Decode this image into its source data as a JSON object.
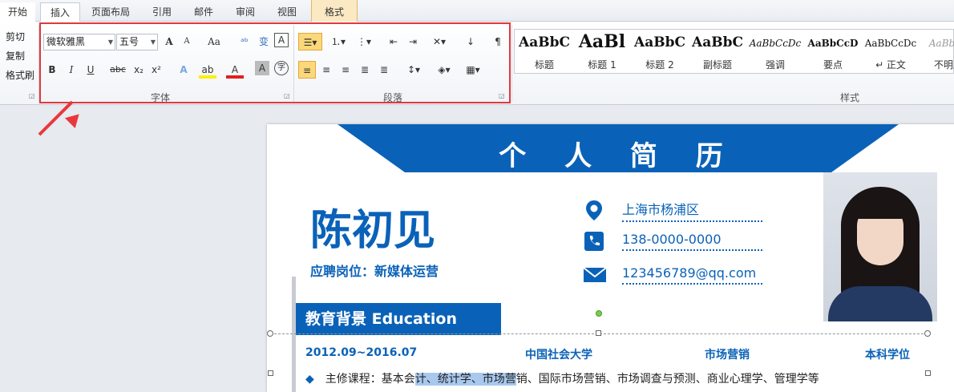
{
  "tabs": [
    {
      "label": "开始",
      "active": true
    },
    {
      "label": "插入",
      "active": false
    },
    {
      "label": "页面布局",
      "active": false
    },
    {
      "label": "引用",
      "active": false
    },
    {
      "label": "邮件",
      "active": false
    },
    {
      "label": "审阅",
      "active": false
    },
    {
      "label": "视图",
      "active": false
    },
    {
      "label": "格式",
      "active": false,
      "contextual": true
    }
  ],
  "clipboard": {
    "cut": "剪切",
    "copy": "复制",
    "format_painter": "格式刷"
  },
  "font": {
    "group_label": "字体",
    "font_name": "微软雅黑",
    "font_size": "五号",
    "grow": "A",
    "shrink": "A",
    "change_case": "Aa",
    "bold": "B",
    "italic": "I",
    "underline": "U",
    "strikethrough": "abc",
    "subscript": "x₂",
    "superscript": "x²",
    "highlight": "ab",
    "font_color": "A",
    "shading": "A",
    "enclose": "字"
  },
  "paragraph": {
    "group_label": "段落"
  },
  "styles": {
    "group_label": "样式",
    "items": [
      {
        "sample": "AaBbC",
        "name": "标题"
      },
      {
        "sample": "AaBl",
        "name": "标题 1"
      },
      {
        "sample": "AaBbC",
        "name": "标题 2"
      },
      {
        "sample": "AaBbC",
        "name": "副标题"
      },
      {
        "sample": "AaBbCcDc",
        "name": "强调"
      },
      {
        "sample": "AaBbCcD",
        "name": "要点"
      },
      {
        "sample": "AaBbCcDc",
        "name": "↵ 正文"
      },
      {
        "sample": "AaBbCc",
        "name": "不明显"
      }
    ]
  },
  "document": {
    "banner_title": "个 人 简 历",
    "name": "陈初见",
    "position": "应聘岗位：新媒体运营",
    "address": "上海市杨浦区",
    "phone": "138-0000-0000",
    "email": "123456789@qq.com",
    "section_title": "教育背景  Education",
    "edu": {
      "period": "2012.09~2016.07",
      "school": "中国社会大学",
      "major": "市场营销",
      "degree": "本科学位"
    },
    "course_prefix": "主修课程：基本会",
    "course_selected": "计、统计学、市场营",
    "course_suffix": "销、国际市场营销、市场调查与预测、商业心理学、管理学等",
    "bullet": "◆"
  },
  "colors": {
    "accent": "#0a62b8",
    "annotation": "#e8383d"
  }
}
